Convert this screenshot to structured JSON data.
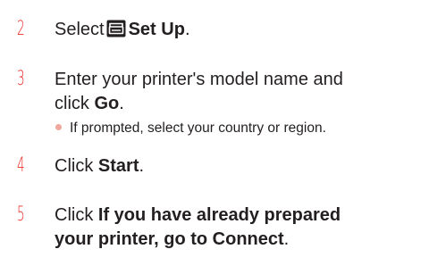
{
  "steps": [
    {
      "number": "2",
      "prefix": "Select",
      "bold": "Set Up",
      "suffix": ".",
      "icon": "printer-setup-icon"
    },
    {
      "number": "3",
      "line1": "Enter your printer's model name and",
      "line2_prefix": "click",
      "bold": "Go",
      "suffix": ".",
      "note": "If prompted, select your country or region."
    },
    {
      "number": "4",
      "prefix": "Click",
      "bold": "Start",
      "suffix": "."
    },
    {
      "number": "5",
      "prefix": "Click",
      "bold_line1": "If you have already prepared",
      "bold_line2": "your printer, go to Connect",
      "suffix": "."
    }
  ],
  "colors": {
    "step_number": "#ee2a24",
    "bullet": "#f0a79c",
    "text": "#231f20"
  }
}
